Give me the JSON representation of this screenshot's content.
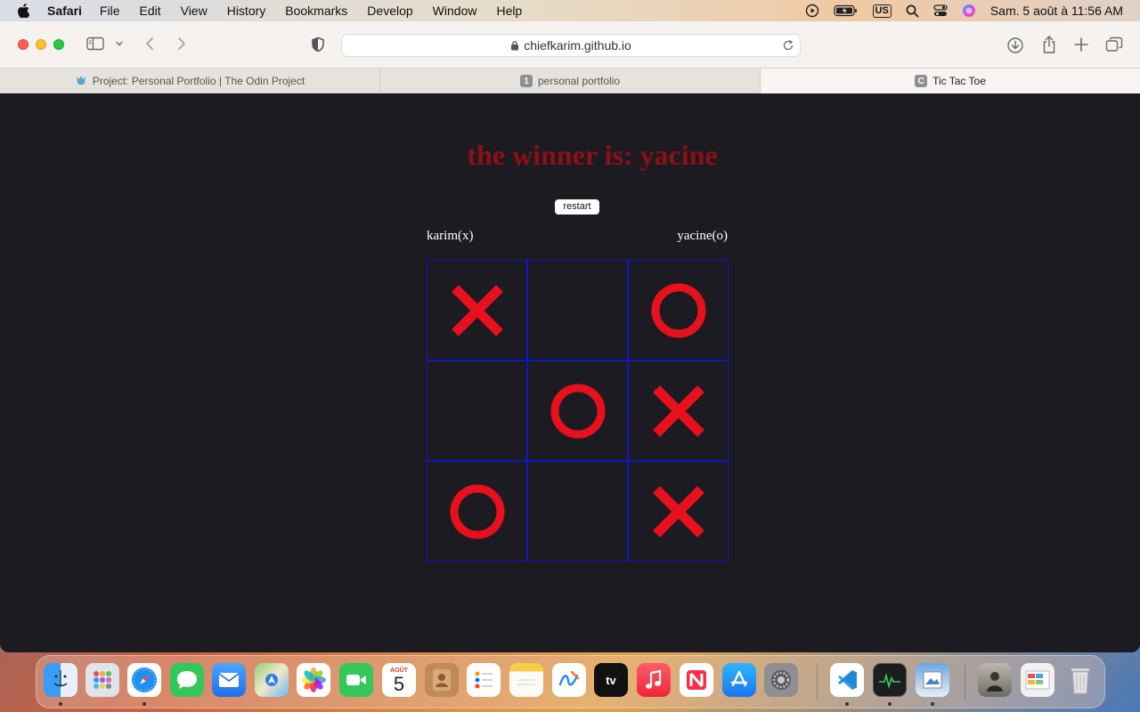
{
  "menubar": {
    "app_name": "Safari",
    "items": [
      "File",
      "Edit",
      "View",
      "History",
      "Bookmarks",
      "Develop",
      "Window",
      "Help"
    ],
    "input_source": "US",
    "clock": "Sam. 5 août à 11:56 AM"
  },
  "browser": {
    "url": "chiefkarim.github.io",
    "tabs": [
      {
        "title": "Project: Personal Portfolio | The Odin Project",
        "favicon": "odin-icon",
        "active": false
      },
      {
        "title": "personal portfolio",
        "favicon_text": "1",
        "active": false
      },
      {
        "title": "Tic Tac Toe",
        "favicon_text": "C",
        "active": true
      }
    ]
  },
  "game": {
    "winner_text": "the winner is: yacine",
    "restart_label": "restart",
    "player_x": "karim(x)",
    "player_o": "yacine(o)",
    "board": [
      "x",
      "",
      "o",
      "",
      "o",
      "x",
      "o",
      "",
      "x"
    ],
    "colors": {
      "mark": "#e8101c",
      "grid": "#1313c8",
      "winner": "#8e0f14",
      "background": "#1c1b22"
    }
  },
  "dock": {
    "apps": [
      "Finder",
      "Launchpad",
      "Safari",
      "Messages",
      "Mail",
      "Maps",
      "Photos",
      "FaceTime",
      "Calendar",
      "Contacts",
      "Reminders",
      "Notes",
      "Freeform",
      "TV",
      "Music",
      "News",
      "App Store",
      "System Settings",
      "Visual Studio Code",
      "Activity Monitor",
      "Preview",
      "Photo",
      "Window",
      "Trash"
    ],
    "calendar_month": "AOÛT",
    "calendar_day": "5",
    "tv_label": "tv"
  }
}
